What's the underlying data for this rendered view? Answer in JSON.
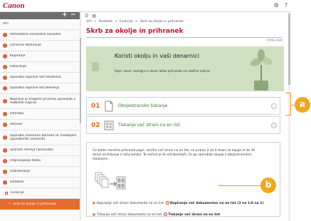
{
  "header": {
    "logo": "Canon",
    "icons": [
      "gear-icon",
      "help-icon"
    ],
    "toolbar_icons": [
      "list-icon",
      "print-icon"
    ],
    "sidebar_controls": [
      "+",
      "−"
    ]
  },
  "sidebar": {
    "items": [
      {
        "label": "Vrh",
        "type": "plain"
      },
      {
        "label": "Pomembna varnostna navodila",
        "type": "chapter"
      },
      {
        "label": "Osnovno delovanje",
        "type": "chapter"
      },
      {
        "label": "Kopiranje",
        "type": "chapter"
      },
      {
        "label": "Faksiranje",
        "type": "chapter"
      },
      {
        "label": "Uporaba naprave kot tiskalnika",
        "type": "chapter"
      },
      {
        "label": "Uporaba naprave kot skenerja",
        "type": "chapter"
      },
      {
        "label": "Naprave je mogoče priročno upravljati z mobilnih naprav",
        "type": "chapter",
        "tall": true
      },
      {
        "label": "Omrežja",
        "type": "chapter"
      },
      {
        "label": "Varnost",
        "type": "chapter"
      },
      {
        "label": "Uporaba vmesnika Remote UI (Oddaljeni uporabniški vmesnik)",
        "type": "chapter",
        "tall": true
      },
      {
        "label": "Seznam menija nastavitev",
        "type": "chapter"
      },
      {
        "label": "Odpravljanje težav",
        "type": "chapter"
      },
      {
        "label": "Vzdrževanje",
        "type": "chapter"
      },
      {
        "label": "Dodatek",
        "type": "chapter"
      },
      {
        "label": "Funkcije",
        "type": "sub"
      },
      {
        "label": "Skrb za okolje in prihranek",
        "type": "current"
      }
    ]
  },
  "breadcrumb": [
    "Vrh",
    "Dodatek",
    "Funkcije",
    "Skrb za okolje in prihranek"
  ],
  "breadcrumb_separator": ">",
  "page": {
    "title": "Skrb za okolje in prihranek",
    "doc_id": "0YWE-0EW"
  },
  "banner": {
    "title": "Koristi okolju in vaši denarnici",
    "text": "Papir, toner, energijo in denar lahko prihranite na različne načine."
  },
  "features": [
    {
      "number": "01",
      "label": "Obojestransko tiskanje",
      "expand": "⌄"
    },
    {
      "number": "02",
      "label": "Tiskanje več strani na en list",
      "expand": "⌄"
    }
  ],
  "detail": {
    "intro": "Če želite resnično prihraniti papir, skrčite več strani na en list, na primer 2 ali 4 strani za kopije in do 16 strani za tiskanje z računalnika. Te načine je še učinkovitejši, če ga uporabite skupaj z obojestranskim tiskanjem.",
    "bullets": [
      {
        "prefix": "Kopiranje več strani dokumenta na en list:",
        "option": "Kopiranje več dokumentov na en list (2 na 1/4 na 1)"
      },
      {
        "prefix": "Tiskanje več strani dokumenta na en list:",
        "option": "Tiskanje več strani na en list"
      }
    ]
  },
  "callouts": {
    "a": "a",
    "b": "b"
  },
  "colors": {
    "accent": "#e46c2e",
    "brand": "#c8102e",
    "callout": "#f0a81d",
    "link_green": "#3a7a2a"
  }
}
